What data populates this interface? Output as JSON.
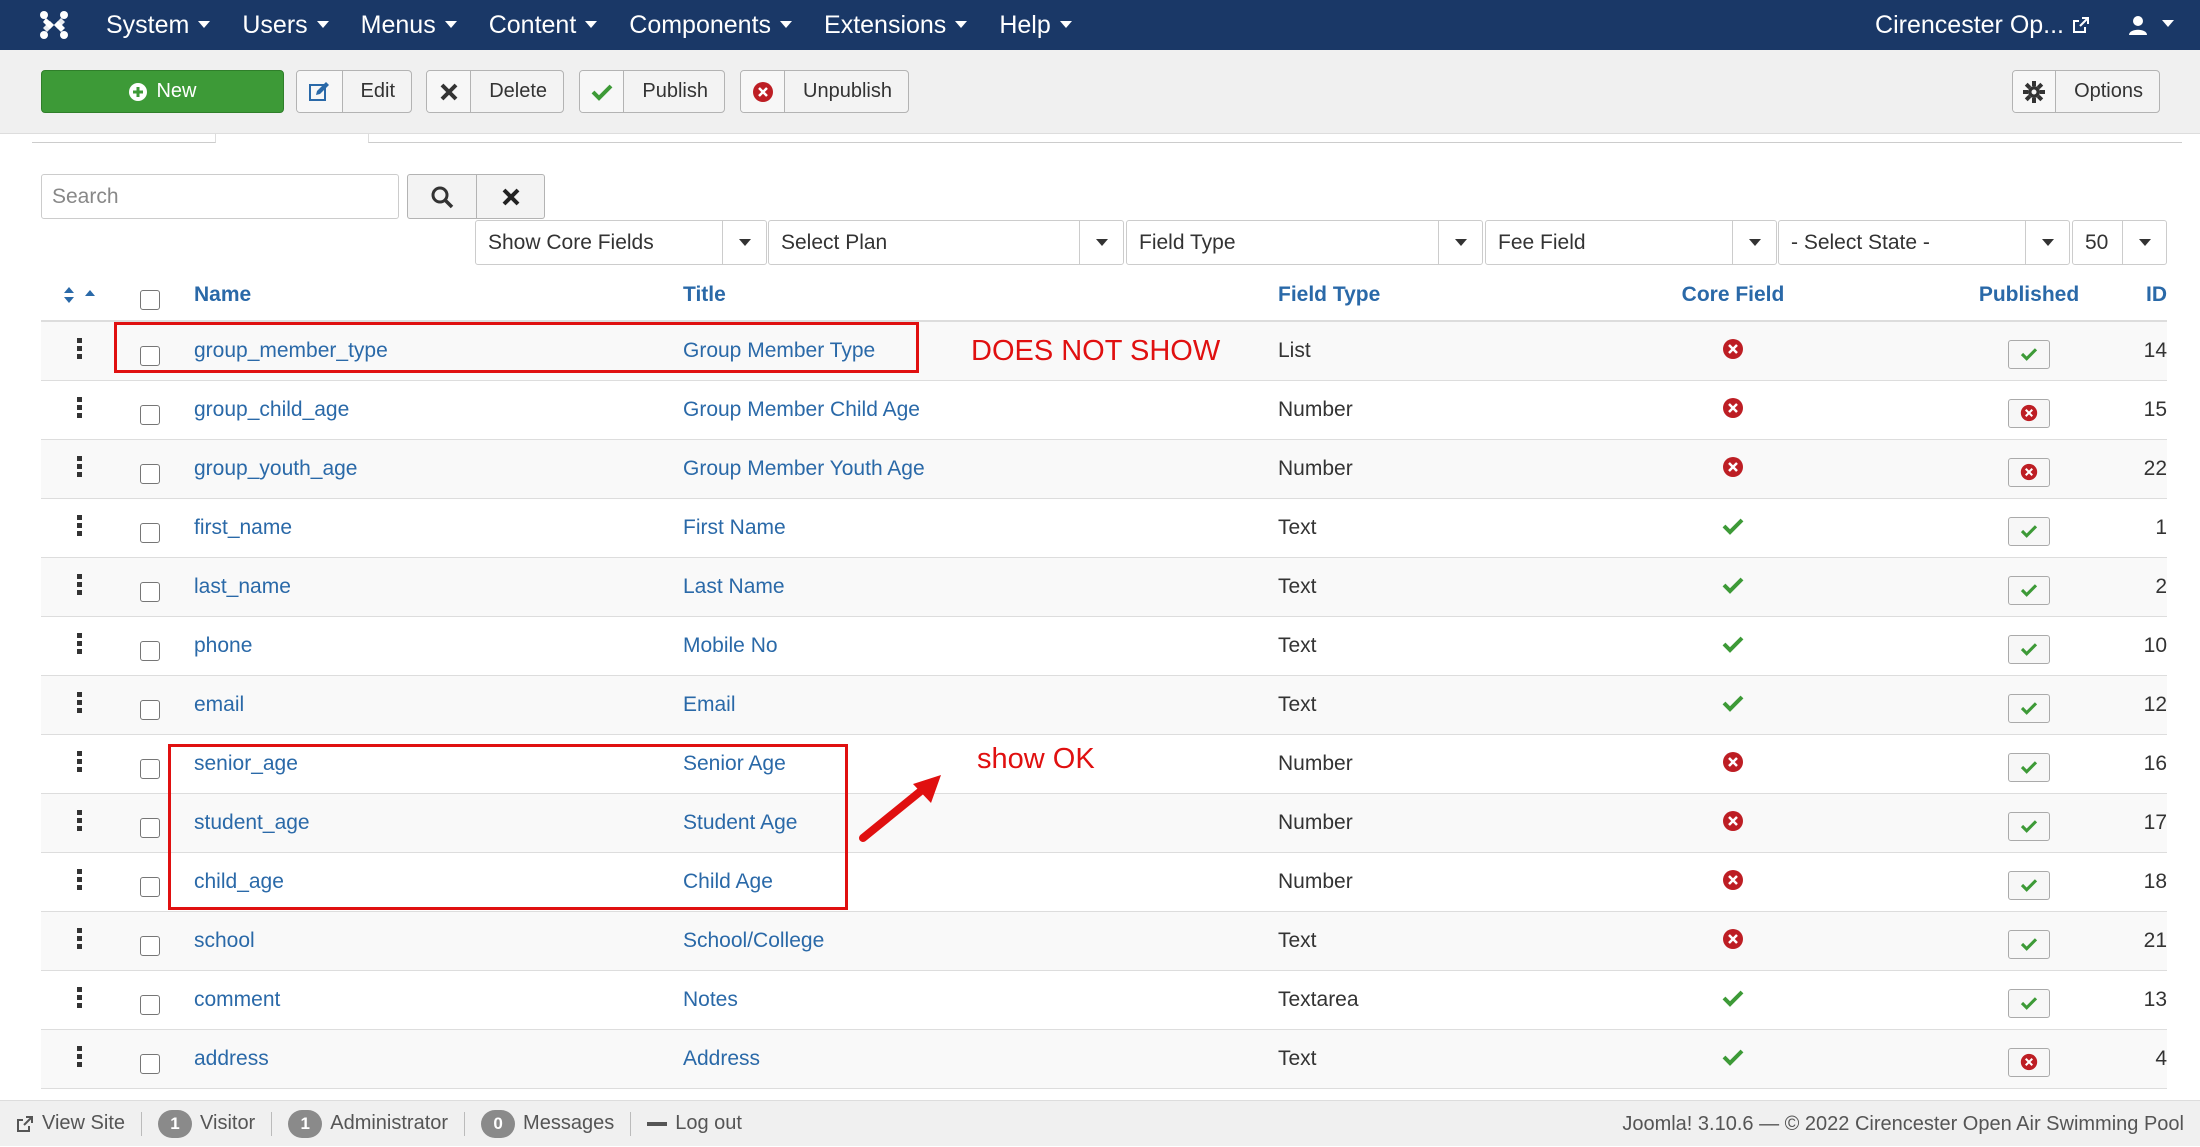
{
  "nav": {
    "menus": [
      "System",
      "Users",
      "Menus",
      "Content",
      "Components",
      "Extensions",
      "Help"
    ],
    "site_name": "Cirencester Op..."
  },
  "toolbar": {
    "new_label": "New",
    "edit_label": "Edit",
    "delete_label": "Delete",
    "publish_label": "Publish",
    "unpublish_label": "Unpublish",
    "options_label": "Options"
  },
  "filters": {
    "search_placeholder": "Search",
    "core_fields": "Show Core Fields",
    "plan": "Select Plan",
    "field_type": "Field Type",
    "fee_field": "Fee Field",
    "state": "- Select State -",
    "limit": "50"
  },
  "table": {
    "headers": {
      "name": "Name",
      "title": "Title",
      "type": "Field Type",
      "core": "Core Field",
      "published": "Published",
      "id": "ID"
    },
    "rows": [
      {
        "name": "group_member_type",
        "title": "Group Member Type",
        "type": "List",
        "core": "no",
        "published": "yes",
        "id": "14"
      },
      {
        "name": "group_child_age",
        "title": "Group Member Child Age",
        "type": "Number",
        "core": "no",
        "published": "no",
        "id": "15"
      },
      {
        "name": "group_youth_age",
        "title": "Group Member Youth Age",
        "type": "Number",
        "core": "no",
        "published": "no",
        "id": "22"
      },
      {
        "name": "first_name",
        "title": "First Name",
        "type": "Text",
        "core": "yes",
        "published": "yes",
        "id": "1"
      },
      {
        "name": "last_name",
        "title": "Last Name",
        "type": "Text",
        "core": "yes",
        "published": "yes",
        "id": "2"
      },
      {
        "name": "phone",
        "title": "Mobile No",
        "type": "Text",
        "core": "yes",
        "published": "yes",
        "id": "10"
      },
      {
        "name": "email",
        "title": "Email",
        "type": "Text",
        "core": "yes",
        "published": "yes",
        "id": "12"
      },
      {
        "name": "senior_age",
        "title": "Senior Age",
        "type": "Number",
        "core": "no",
        "published": "yes",
        "id": "16"
      },
      {
        "name": "student_age",
        "title": "Student Age",
        "type": "Number",
        "core": "no",
        "published": "yes",
        "id": "17"
      },
      {
        "name": "child_age",
        "title": "Child Age",
        "type": "Number",
        "core": "no",
        "published": "yes",
        "id": "18"
      },
      {
        "name": "school",
        "title": "School/College",
        "type": "Text",
        "core": "no",
        "published": "yes",
        "id": "21"
      },
      {
        "name": "comment",
        "title": "Notes",
        "type": "Textarea",
        "core": "yes",
        "published": "yes",
        "id": "13"
      },
      {
        "name": "address",
        "title": "Address",
        "type": "Text",
        "core": "yes",
        "published": "no",
        "id": "4"
      }
    ]
  },
  "annotations": {
    "does_not_show": "DOES NOT SHOW",
    "show_ok": "show OK"
  },
  "footer": {
    "view_site": "View Site",
    "visitor_count": "1",
    "visitor_label": "Visitor",
    "admin_count": "1",
    "admin_label": "Administrator",
    "messages_count": "0",
    "messages_label": "Messages",
    "logout": "Log out",
    "copyright": "Joomla! 3.10.6 — © 2022 Cirencester Open Air Swimming Pool"
  },
  "colors": {
    "navbar": "#1a3867",
    "new_button": "#3d9a37",
    "link": "#2a69a8",
    "success": "#3d9a37",
    "danger": "#bd1e24",
    "annotation": "#e01010"
  },
  "icons": {
    "logo": "joomla-logo-icon",
    "external": "external-link-icon",
    "user": "user-icon",
    "new": "plus-circle-icon",
    "edit": "edit-icon",
    "delete": "cross-icon",
    "publish": "check-icon",
    "unpublish": "times-circle-icon",
    "options": "gear-icon",
    "search": "search-icon",
    "clear": "clear-icon"
  }
}
